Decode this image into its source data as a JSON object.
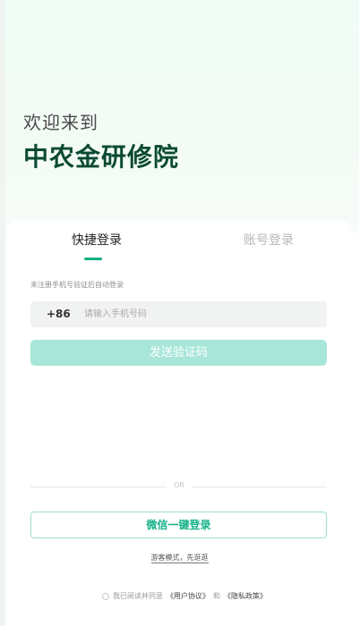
{
  "hero": {
    "welcome": "欢迎来到",
    "app_name": "中农金研修院"
  },
  "tabs": {
    "quick_login": "快捷登录",
    "account_login": "账号登录"
  },
  "form": {
    "hint": "未注册手机号验证后自动登录",
    "country_code": "+86",
    "phone_placeholder": "请输入手机号码",
    "send_code_label": "发送验证码"
  },
  "divider": {
    "or_label": "OR"
  },
  "wechat_login_label": "微信一键登录",
  "guest_mode_label": "游客模式，先逛逛",
  "agreement": {
    "prefix": "我已阅读并同意",
    "user_agreement": "《用户协议》",
    "conjunction": "和",
    "privacy_policy": "《隐私政策》"
  },
  "colors": {
    "brand_green": "#11b084",
    "title_dark_green": "#0b4a33",
    "disabled_button": "#a7e6d8"
  }
}
